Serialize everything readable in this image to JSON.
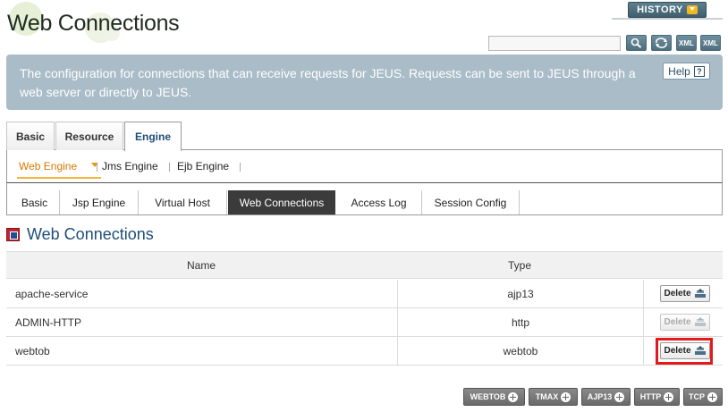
{
  "header": {
    "title": "Web Connections",
    "history_label": "HISTORY"
  },
  "toolbar": {
    "search_value": "",
    "icons": [
      "search-icon",
      "refresh-icon",
      "xml-export-icon",
      "xml-import-icon"
    ],
    "xml_label": "XML"
  },
  "description": {
    "text": "The configuration for connections that can receive requests for JEUS. Requests can be sent to JEUS through a web server or directly to JEUS.",
    "help_label": "Help",
    "help_icon": "?"
  },
  "top_tabs": [
    {
      "label": "Basic"
    },
    {
      "label": "Resource"
    },
    {
      "label": "Engine"
    }
  ],
  "engine_tabs": [
    {
      "label": "Web Engine"
    },
    {
      "label": "Jms Engine"
    },
    {
      "label": "Ejb Engine"
    }
  ],
  "web_tabs": [
    {
      "label": "Basic"
    },
    {
      "label": "Jsp Engine"
    },
    {
      "label": "Virtual Host"
    },
    {
      "label": "Web Connections"
    },
    {
      "label": "Access Log"
    },
    {
      "label": "Session Config"
    }
  ],
  "section": {
    "title": "Web Connections"
  },
  "table": {
    "columns": [
      "Name",
      "Type"
    ],
    "rows": [
      {
        "name": "apache-service",
        "type": "ajp13",
        "delete_label": "Delete",
        "delete_enabled": true
      },
      {
        "name": "ADMIN-HTTP",
        "type": "http",
        "delete_label": "Delete",
        "delete_enabled": false
      },
      {
        "name": "webtob",
        "type": "webtob",
        "delete_label": "Delete",
        "delete_enabled": true
      }
    ]
  },
  "add_buttons": [
    {
      "label": "WEBTOB"
    },
    {
      "label": "TMAX"
    },
    {
      "label": "AJP13"
    },
    {
      "label": "HTTP"
    },
    {
      "label": "TCP"
    }
  ],
  "colors": {
    "accent_blue": "#1f4e79",
    "active_orange": "#d67a00",
    "highlight_red": "#e41a1a",
    "banner": "#a9bcc8"
  }
}
